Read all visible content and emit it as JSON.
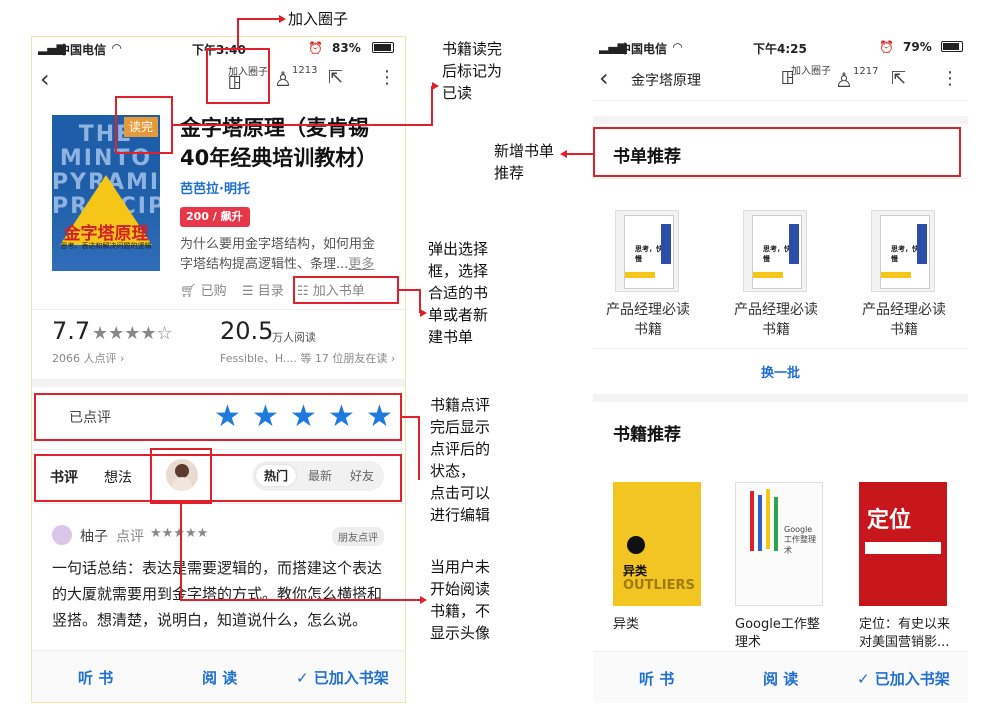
{
  "annotations": {
    "join_circle": "加入圈子",
    "mark_read": [
      "书籍读完",
      "后标记为",
      "已读"
    ],
    "add_list": [
      "弹出选择",
      "框，选择",
      "合适的书",
      "单或者新",
      "建书单"
    ],
    "rated": [
      "书籍点评",
      "完后显示",
      "点评后的",
      "状态，",
      "点击可以",
      "进行编辑"
    ],
    "no_avatar": [
      "当用户未",
      "开始阅读",
      "书籍，不",
      "显示头像"
    ],
    "new_list": [
      "新增书单",
      "推荐"
    ]
  },
  "phone1": {
    "status": {
      "carrier": "中国电信",
      "time": "下午3:40",
      "battery": "83%",
      "battery_fill": 0.83
    },
    "top": {
      "join_label": "加入圈子",
      "member_count": "1213"
    },
    "book": {
      "cover_en": "THE MINTO PYRAMID PRINCIPLE",
      "cover_cn": "金字塔原理",
      "cover_sub": "思考、表达和解决问题的逻辑",
      "read_tag": "读完",
      "title": "金字塔原理（麦肯锡40年经典培训教材）",
      "author": "芭芭拉·明托",
      "badge": "200 / 飙升 ›",
      "desc": "为什么要用金字塔结构，如何用金字塔结构提高逻辑性、条理...",
      "more": "更多"
    },
    "ops": {
      "bought": "已购",
      "toc": "目录",
      "add_list": "加入书单"
    },
    "stats": {
      "score": "7.7",
      "stars": "★★★★☆",
      "rate_count": "2066 人点评 ›",
      "readers": "20.5",
      "readers_unit": "万人阅读",
      "friends": "Fessible、H.... 等 17 位朋友在读 ›"
    },
    "rating": {
      "label": "已点评",
      "stars": [
        "★",
        "★",
        "★",
        "★",
        "★"
      ]
    },
    "tabs": {
      "review": "书评",
      "thoughts": "想法",
      "hot": "热门",
      "latest": "最新",
      "friends": "好友"
    },
    "comment": {
      "user": "柚子",
      "action": "点评",
      "stars": "★★★★★",
      "tag": "朋友点评",
      "text": "一句话总结：表达是需要逻辑的，而搭建这个表达的大厦就需要用到金字塔的方式。教你怎么横搭和竖搭。想清楚，说明白，知道说什么，怎么说。"
    },
    "bottom": {
      "listen": "听 书",
      "read": "阅 读",
      "shelf": "✓ 已加入书架"
    }
  },
  "phone2": {
    "status": {
      "carrier": "中国电信",
      "time": "下午4:25",
      "battery": "79%",
      "battery_fill": 0.79
    },
    "top": {
      "title": "金字塔原理",
      "join_label": "加入圈子",
      "member_count": "1217"
    },
    "booklist": {
      "title": "书单推荐",
      "items": [
        "产品经理必读书籍",
        "产品经理必读书籍",
        "产品经理必读书籍"
      ],
      "cover_text": "思考，快与慢",
      "refresh": "换一批"
    },
    "books": {
      "title": "书籍推荐",
      "items": [
        {
          "name": "异类",
          "cover": "异类"
        },
        {
          "name": "Google工作整理术",
          "cover": "Google 工作整理术"
        },
        {
          "name": "定位：有史以来对美国营销影...",
          "cover": "定位"
        }
      ]
    },
    "bottom": {
      "listen": "听 书",
      "read": "阅 读",
      "shelf": "✓ 已加入书架"
    }
  },
  "colors": {
    "accent": "#1f7ae0",
    "annotation": "#e0202a",
    "read_tag": "#e59a3a"
  }
}
